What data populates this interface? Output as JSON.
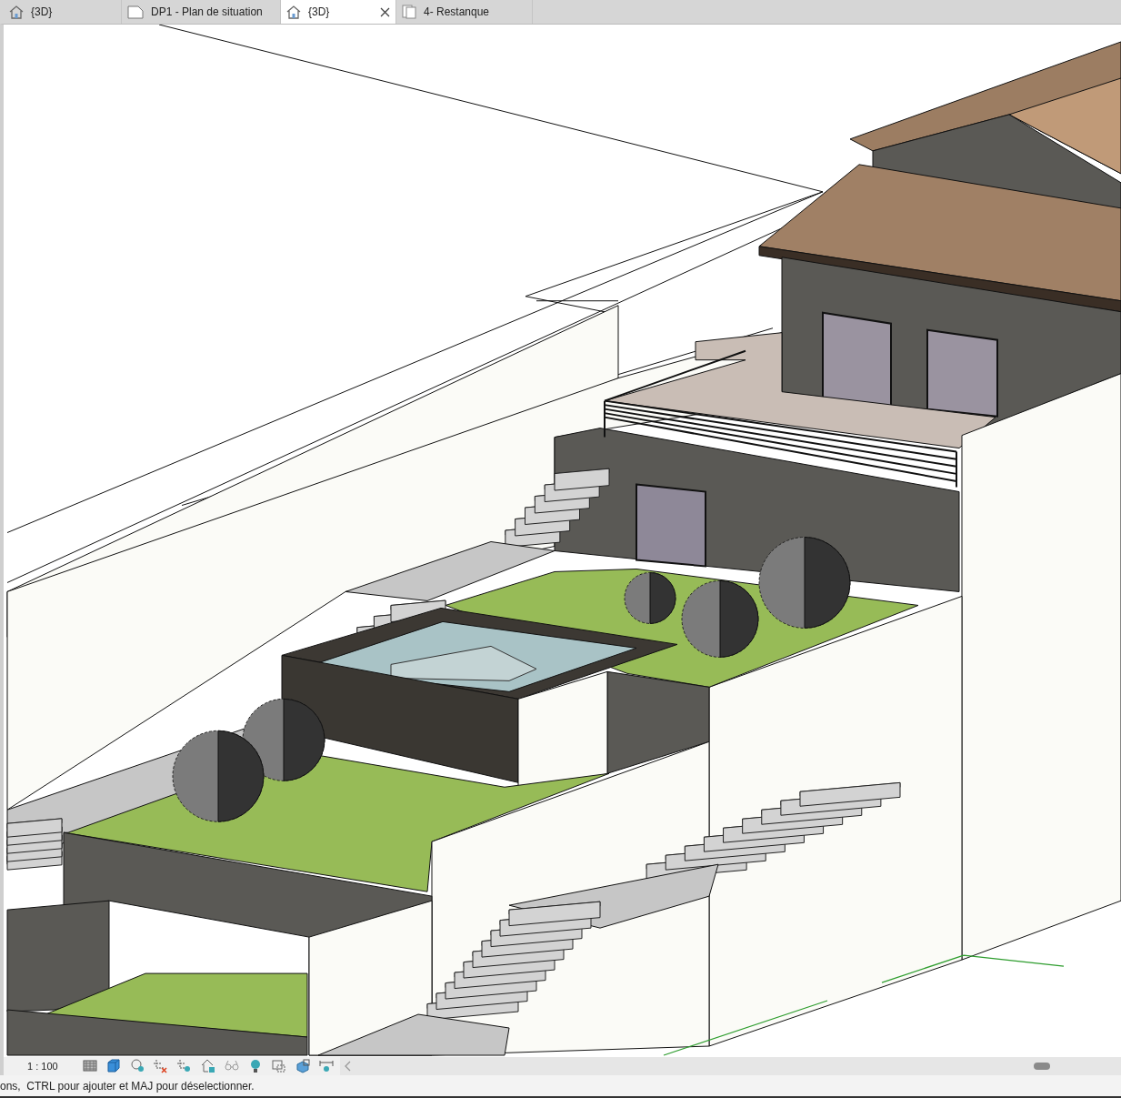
{
  "tabs": [
    {
      "kind": "view3d",
      "label": "{3D}",
      "selected": false
    },
    {
      "kind": "sheet",
      "label": "DP1 - Plan de situation",
      "selected": false
    },
    {
      "kind": "view3d",
      "label": "{3D}",
      "selected": true
    },
    {
      "kind": "document",
      "label": "4- Restanque",
      "selected": false
    }
  ],
  "view_control_bar": {
    "scale": "1 : 100"
  },
  "status_bar": {
    "text": "ons,  CTRL pour ajouter et MAJ pour déselectionner."
  }
}
